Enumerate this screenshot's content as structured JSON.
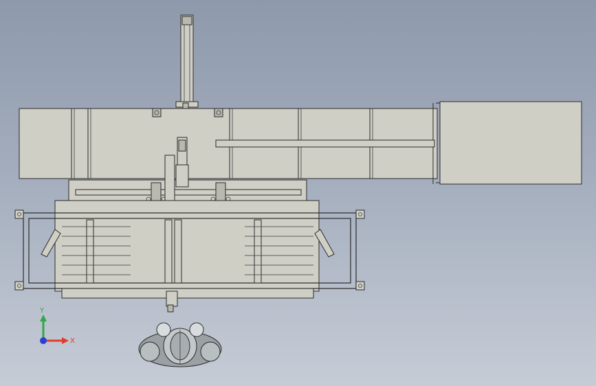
{
  "view": {
    "background_top": "#8e99ab",
    "background_bottom": "#c6ccd6",
    "part_fill": "#cfcfc6",
    "edge_color": "#2b2b2b"
  },
  "triad": {
    "x_label": "X",
    "y_label": "Y",
    "x_color": "#e23b2e",
    "y_color": "#2fa84a",
    "z_color": "#2b3fd6"
  },
  "icons": [
    "axis-triad-icon",
    "view-orientation-icon"
  ]
}
